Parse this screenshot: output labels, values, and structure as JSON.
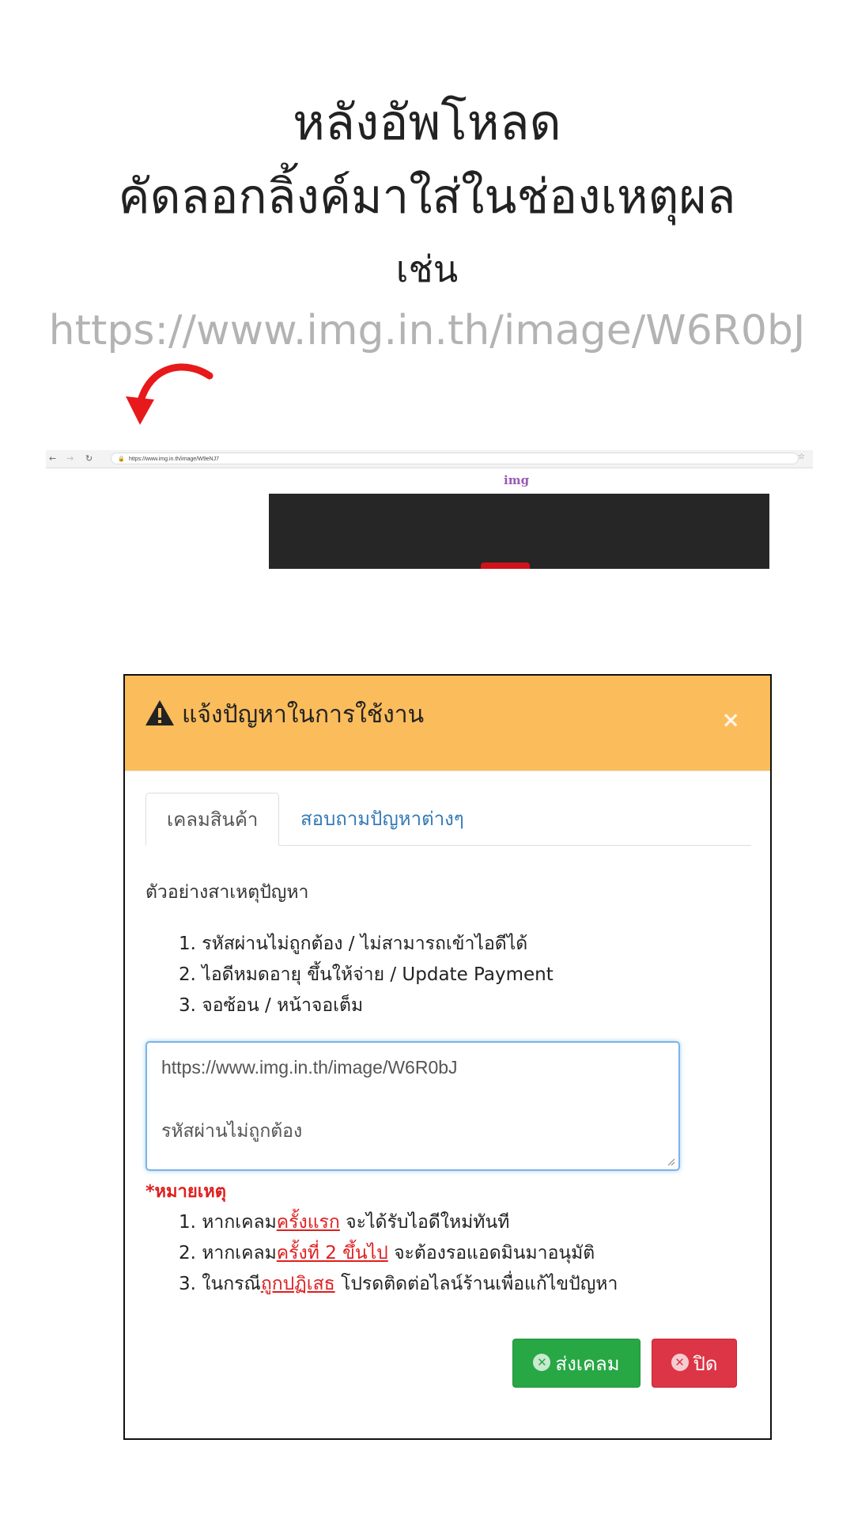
{
  "headline": {
    "line1": "หลังอัพโหลด",
    "line2": "คัดลอกลิ้งค์มาใส่ในช่องเหตุผล",
    "line3": "เช่น",
    "example_url": "https://www.img.in.th/image/W6R0bJ"
  },
  "browser": {
    "address": "https://www.img.in.th/image/W9eNJ7",
    "logo": "img",
    "icons": [
      "back-icon",
      "forward-icon",
      "reload-icon",
      "lock-icon",
      "star-icon"
    ]
  },
  "modal": {
    "title": "แจ้งปัญหาในการใช้งาน",
    "close_symbol": "×",
    "header_color": "#fbbc5b",
    "tabs": [
      {
        "label": "เคลมสินค้า",
        "active": true
      },
      {
        "label": "สอบถามปัญหาต่างๆ",
        "active": false
      }
    ],
    "examples_label": "ตัวอย่างสาเหตุปัญหา",
    "examples": [
      "1. รหัสผ่านไม่ถูกต้อง / ไม่สามารถเข้าไอดีได้",
      "2. ไอดีหมดอายุ ขึ้นให้จ่าย / Update Payment",
      "3. จอซ้อน / หน้าจอเต็ม"
    ],
    "reason": {
      "line1": "https://www.img.in.th/image/W6R0bJ",
      "line2": "รหัสผ่านไม่ถูกต้อง"
    },
    "note_title": "*หมายเหตุ",
    "notes": [
      {
        "prefix": "1. หากเคลม",
        "highlight": "ครั้งแรก",
        "suffix": " จะได้รับไอดีใหม่ทันที"
      },
      {
        "prefix": "2. หากเคลม",
        "highlight": "ครั้งที่ 2 ขึ้นไป",
        "suffix": " จะต้องรอแอดมินมาอนุมัติ"
      },
      {
        "prefix": "3. ในกรณี",
        "highlight": "ถูกปฏิเสธ",
        "suffix": " โปรดติดต่อไลน์ร้านเพื่อแก้ไขปัญหา"
      }
    ],
    "buttons": {
      "submit_label": "ส่งเคลม",
      "close_label": "ปิด",
      "submit_color": "#28a745",
      "close_color": "#dc3545"
    }
  }
}
